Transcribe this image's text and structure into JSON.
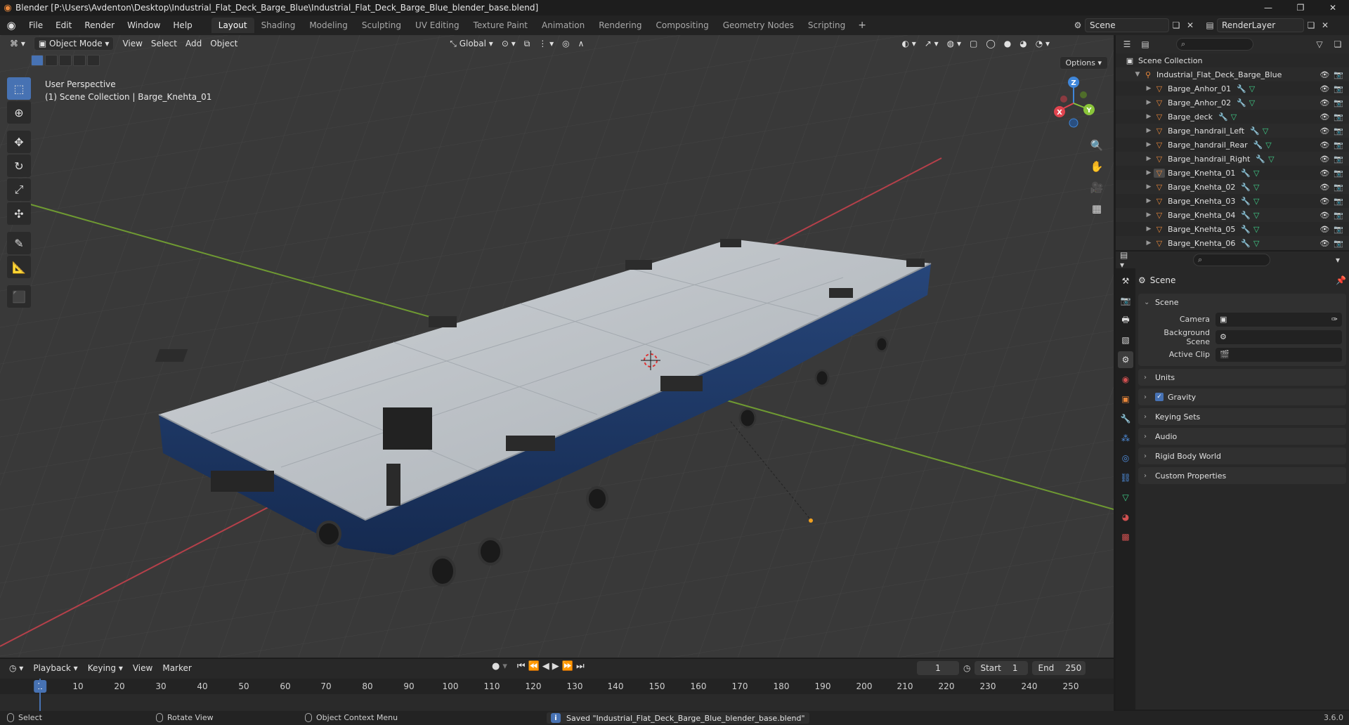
{
  "window": {
    "title": "Blender [P:\\Users\\Avdenton\\Desktop\\Industrial_Flat_Deck_Barge_Blue\\Industrial_Flat_Deck_Barge_Blue_blender_base.blend]",
    "minimize_icon": "minimize-icon",
    "maximize_icon": "maximize-icon",
    "close_icon": "close-icon"
  },
  "menu": [
    "File",
    "Edit",
    "Render",
    "Window",
    "Help"
  ],
  "workspaces": {
    "tabs": [
      "Layout",
      "Shading",
      "Modeling",
      "Sculpting",
      "UV Editing",
      "Texture Paint",
      "Animation",
      "Rendering",
      "Compositing",
      "Geometry Nodes",
      "Scripting"
    ],
    "active": "Layout"
  },
  "scene_selector": {
    "scene": "Scene",
    "view_layer": "RenderLayer"
  },
  "viewport": {
    "mode": "Object Mode",
    "menus": [
      "View",
      "Select",
      "Add",
      "Object"
    ],
    "orientation": "Global",
    "options_label": "Options",
    "perspective_label": "User Perspective",
    "context_label": "(1) Scene Collection | Barge_Knehta_01",
    "gizmo_axes": {
      "x": "X",
      "y": "Y",
      "z": "Z"
    },
    "colors": {
      "x_axis": "#e0444f",
      "y_axis": "#8ac53a",
      "z_axis": "#3f86d9",
      "hull": "#1f3b6b",
      "deck": "#c8ccd0"
    }
  },
  "toolbar": [
    "select-box-icon",
    "cursor-icon",
    "move-icon",
    "rotate-icon",
    "scale-icon",
    "transform-icon",
    "annotate-icon",
    "measure-icon",
    "add-cube-icon"
  ],
  "outliner": {
    "search_placeholder": "",
    "root": "Scene Collection",
    "collection": "Industrial_Flat_Deck_Barge_Blue",
    "objects": [
      "Barge_Anhor_01",
      "Barge_Anhor_02",
      "Barge_deck",
      "Barge_handrail_Left",
      "Barge_handrail_Rear",
      "Barge_handrail_Right",
      "Barge_Knehta_01",
      "Barge_Knehta_02",
      "Barge_Knehta_03",
      "Barge_Knehta_04",
      "Barge_Knehta_05",
      "Barge_Knehta_06"
    ]
  },
  "properties": {
    "context_title": "Scene",
    "scene_panel": {
      "title": "Scene",
      "camera_label": "Camera",
      "camera_value": "",
      "background_label": "Background Scene",
      "background_value": "",
      "clip_label": "Active Clip",
      "clip_value": ""
    },
    "panels": [
      "Units",
      "Gravity",
      "Keying Sets",
      "Audio",
      "Rigid Body World",
      "Custom Properties"
    ],
    "gravity_checked": true
  },
  "timeline": {
    "menus": [
      "Playback",
      "Keying",
      "View",
      "Marker"
    ],
    "current_frame": "1",
    "start_label": "Start",
    "start": "1",
    "end_label": "End",
    "end": "250",
    "ticks": [
      "10",
      "20",
      "30",
      "40",
      "50",
      "60",
      "70",
      "80",
      "90",
      "100",
      "110",
      "120",
      "130",
      "140",
      "150",
      "160",
      "170",
      "180",
      "190",
      "200",
      "210",
      "220",
      "230",
      "240",
      "250"
    ],
    "playhead_label": "1"
  },
  "statusbar": {
    "select": "Select",
    "rotate": "Rotate View",
    "context_menu": "Object Context Menu",
    "message": "Saved \"Industrial_Flat_Deck_Barge_Blue_blender_base.blend\"",
    "version": "3.6.0"
  }
}
